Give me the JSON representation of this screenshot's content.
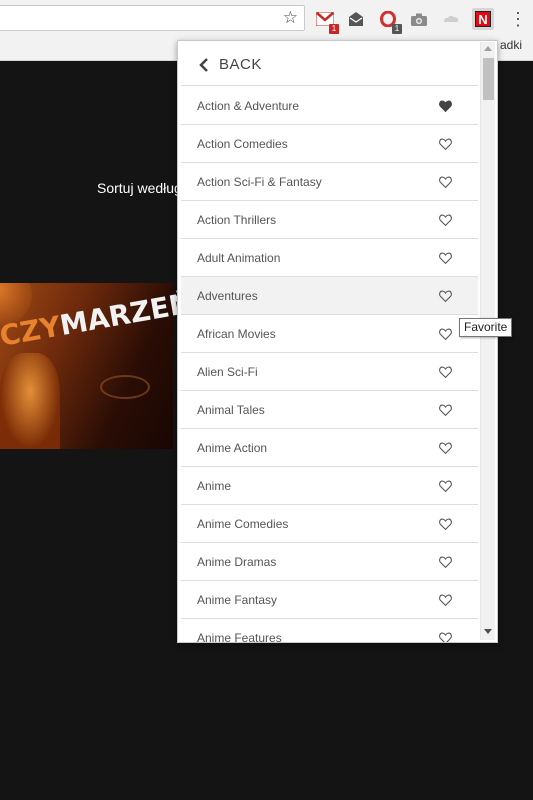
{
  "browser": {
    "extensions": [
      {
        "name": "gmail",
        "badge": "1",
        "badge_color": "#c62828"
      },
      {
        "name": "mail",
        "badge": ""
      },
      {
        "name": "opera",
        "badge": "1",
        "badge_color": "#555555"
      },
      {
        "name": "camera",
        "badge": ""
      },
      {
        "name": "cloud",
        "badge": ""
      },
      {
        "name": "netflix",
        "letter": "N"
      }
    ],
    "bookmark_text": "adki"
  },
  "page": {
    "sort_label": "Sortuj według",
    "poster": {
      "title_part1": "CZY",
      "title_part2": "MARZEŃ"
    }
  },
  "popup": {
    "back_label": "BACK",
    "tooltip": "Favorite",
    "accent": "#e50914",
    "categories": [
      {
        "label": "Action & Adventure",
        "favorite": true
      },
      {
        "label": "Action Comedies",
        "favorite": false
      },
      {
        "label": "Action Sci-Fi & Fantasy",
        "favorite": false
      },
      {
        "label": "Action Thrillers",
        "favorite": false
      },
      {
        "label": "Adult Animation",
        "favorite": false
      },
      {
        "label": "Adventures",
        "favorite": false,
        "hovered": true
      },
      {
        "label": "African Movies",
        "favorite": false
      },
      {
        "label": "Alien Sci-Fi",
        "favorite": false
      },
      {
        "label": "Animal Tales",
        "favorite": false
      },
      {
        "label": "Anime Action",
        "favorite": false
      },
      {
        "label": "Anime",
        "favorite": false
      },
      {
        "label": "Anime Comedies",
        "favorite": false
      },
      {
        "label": "Anime Dramas",
        "favorite": false
      },
      {
        "label": "Anime Fantasy",
        "favorite": false
      },
      {
        "label": "Anime Features",
        "favorite": false
      }
    ]
  }
}
